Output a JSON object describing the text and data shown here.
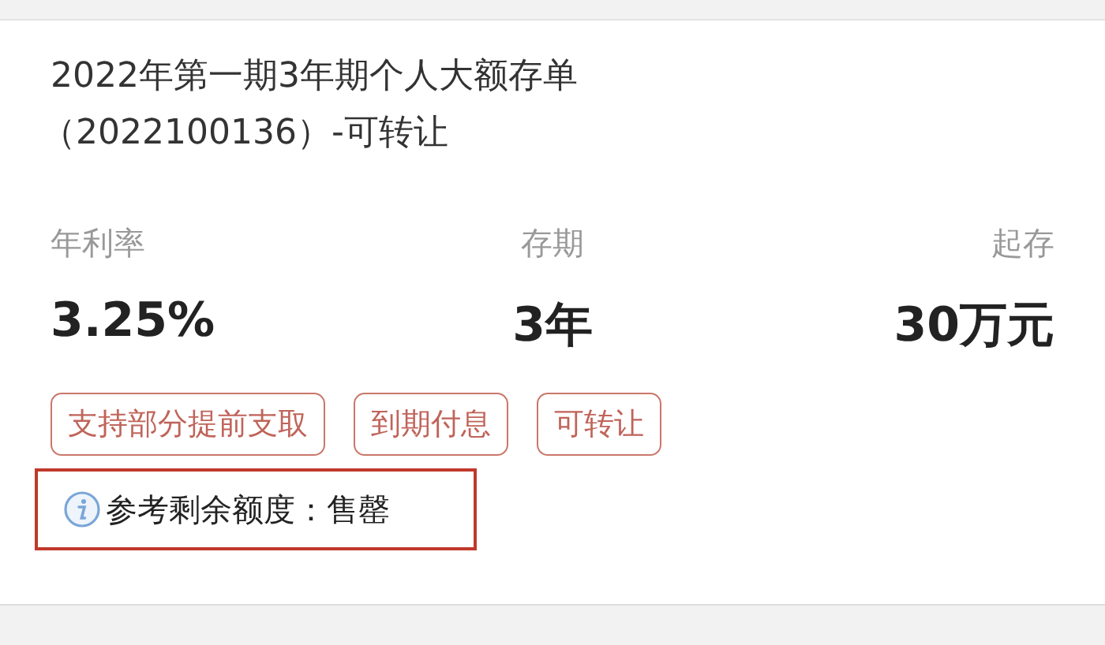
{
  "product": {
    "title": "2022年第一期3年期个人大额存单",
    "code": "（2022100136）-可转让"
  },
  "stats": [
    {
      "label": "年利率",
      "value": "3.25%"
    },
    {
      "label": "存期",
      "value": "3年"
    },
    {
      "label": "起存",
      "value": "30万元"
    }
  ],
  "tags": [
    "支持部分提前支取",
    "到期付息",
    "可转让"
  ],
  "remaining": {
    "text": "参考剩余额度：售罄",
    "highlighted": true
  }
}
